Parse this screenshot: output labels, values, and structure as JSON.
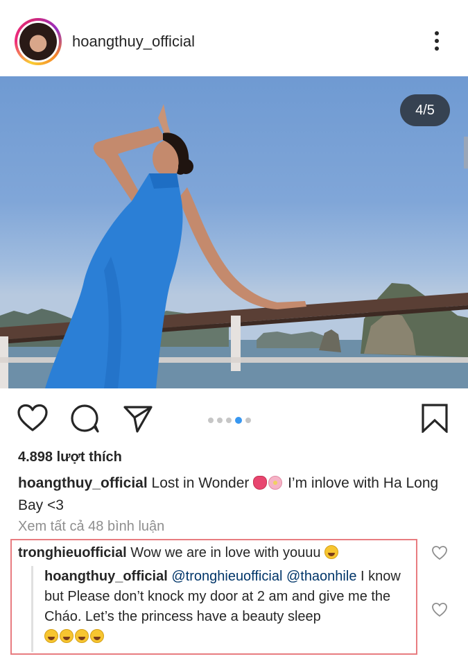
{
  "post": {
    "username": "hoangthuy_official",
    "page_counter": "4/5",
    "carousel_total": 5,
    "carousel_active": 4
  },
  "likes": "4.898 lượt thích",
  "caption": {
    "username": "hoangthuy_official",
    "text_before_emoji": "Lost in Wonder",
    "text_after_emoji": "I’m inlove with Ha Long Bay <3"
  },
  "view_all_comments": "Xem tất cả 48 bình luận",
  "comments": [
    {
      "username": "tronghieuofficial",
      "text": "Wow we are in love with youuu"
    }
  ],
  "reply": {
    "username": "hoangthuy_official",
    "mention1": "@tronghieuofficial",
    "mention2": "@thaonhile",
    "text_line_a": "I know but Please don’t knock my door at 2 am and give me the Cháo.  Let’s the princess have a beauty sleep"
  },
  "icons": {
    "more": "more-vertical-icon",
    "like": "heart-icon",
    "comment": "comment-bubble-icon",
    "share": "send-icon",
    "save": "bookmark-icon"
  },
  "colors": {
    "carousel_active": "#3897f0",
    "highlight_border": "#e87c80",
    "mention": "#003569"
  }
}
